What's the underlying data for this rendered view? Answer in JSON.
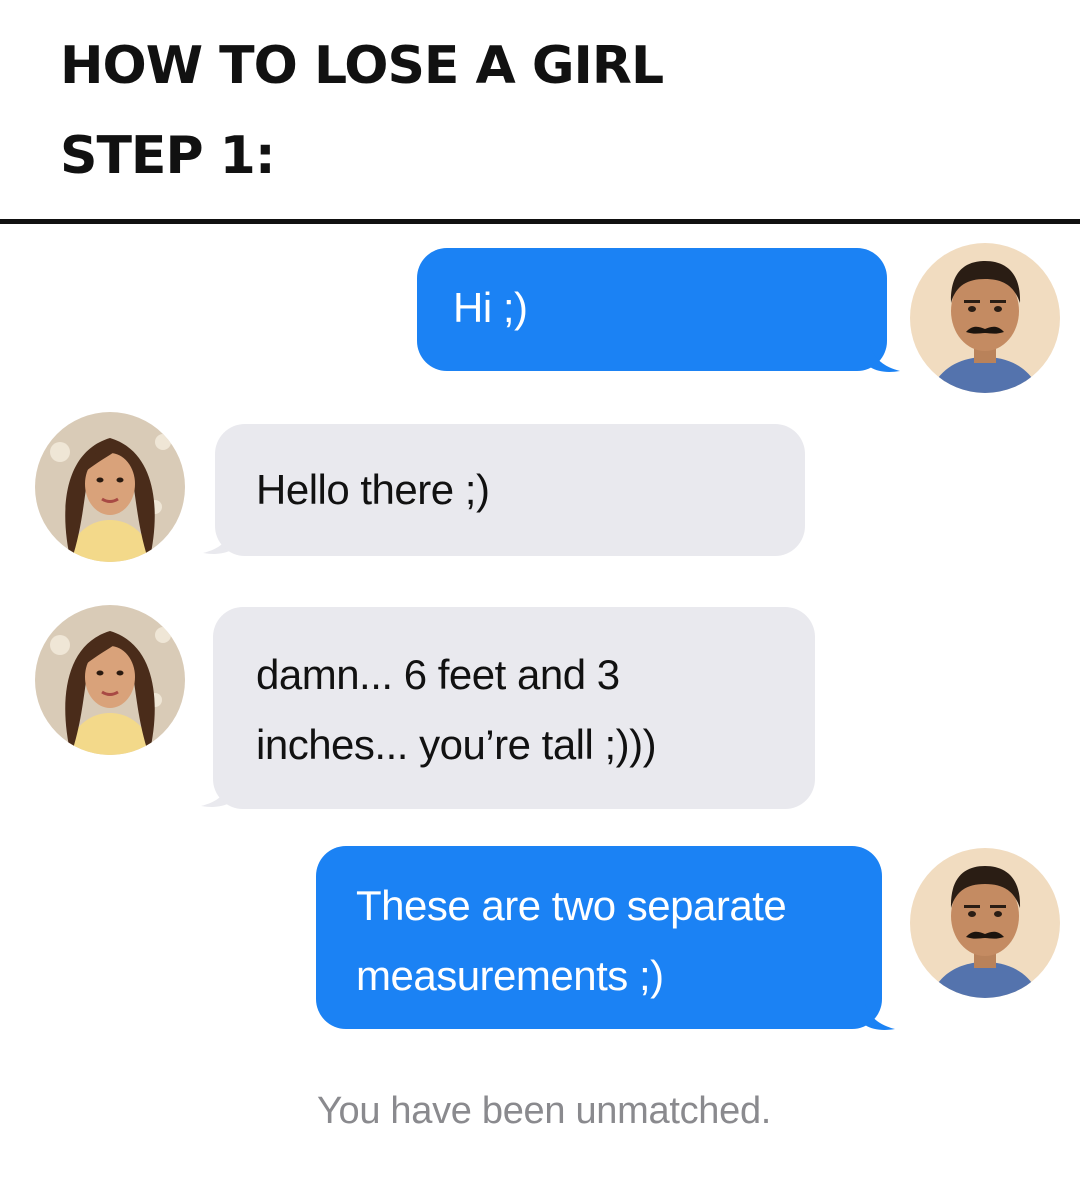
{
  "header": {
    "title_line1": "HOW TO LOSE A GIRL",
    "title_line2": "STEP 1:"
  },
  "messages": [
    {
      "sender": "man",
      "side": "sent",
      "lines": [
        "Hi ;)"
      ]
    },
    {
      "sender": "woman",
      "side": "received",
      "lines": [
        "Hello there ;)"
      ]
    },
    {
      "sender": "woman",
      "side": "received",
      "lines": [
        "damn... 6 feet and 3",
        "inches... you’re tall ;)))"
      ]
    },
    {
      "sender": "man",
      "side": "sent",
      "lines": [
        "These are two separate",
        "measurements ;)"
      ]
    }
  ],
  "status_text": "You have been unmatched.",
  "colors": {
    "sent_bubble": "#1b82f4",
    "received_bubble": "#e9e9ee",
    "status_text": "#8a8a8e"
  },
  "icons": {
    "man_avatar": "man-avatar",
    "woman_avatar": "woman-avatar"
  }
}
